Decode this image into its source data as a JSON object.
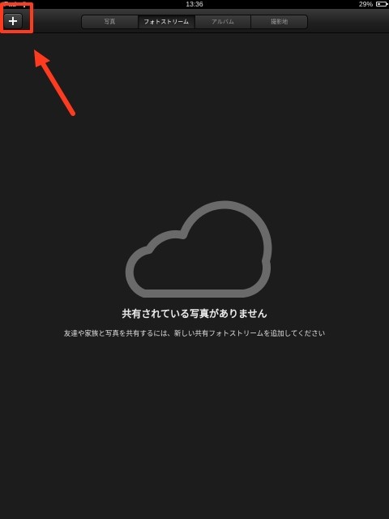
{
  "status_bar": {
    "carrier": "iPad",
    "time": "13:36",
    "battery": "29%"
  },
  "nav": {
    "add_label": "+",
    "segments": [
      "写真",
      "フォトストリーム",
      "アルバム",
      "撮影地"
    ],
    "selected_segment": "フォトストリーム"
  },
  "annotation": {
    "color": "#ff3b1f"
  },
  "empty_state": {
    "title": "共有されている写真がありません",
    "subtitle": "友達や家族と写真を共有するには、新しい共有フォトストリームを追加してください"
  }
}
